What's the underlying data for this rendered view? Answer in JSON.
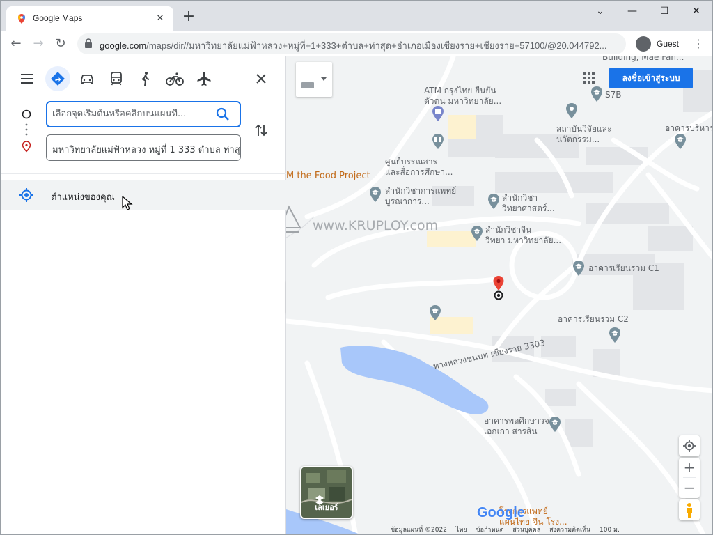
{
  "browser": {
    "tab_title": "Google Maps",
    "new_tab": "+",
    "url_host": "google.com",
    "url_path": "/maps/dir//มหาวิทยาลัยแม่ฟ้าหลวง+หมู่ที่+1+333+ตำบล+ท่าสุด+อำเภอเมืองเชียงราย+เชียงราย+57100/@20.044792...",
    "profile_label": "Guest"
  },
  "panel": {
    "origin_placeholder": "เลือกจุดเริ่มต้นหรือคลิกบนแผนที่...",
    "destination_value": "มหาวิทยาลัยแม่ฟ้าหลวง หมู่ที่ 1 333 ตำบล ท่าสุด",
    "suggestion_label": "ตำแหน่งของคุณ"
  },
  "map": {
    "signin_label": "ลงชื่อเข้าสู่ระบบ",
    "layers_label": "เลเยอร์",
    "watermark": "www.KRUPLOY.com",
    "labels": {
      "building_top": "Building, Mae Fah...",
      "atm": "ATM กรุงไทย ยืนยัน\nตัวตน มหาวิทยาลัย...",
      "s7b": "S7B",
      "research": "สถาบันวิจัยและ\nนวัตกรรม...",
      "admin": "อาคารบริหาร",
      "library": "ศูนย์บรรณสาร\nและสื่อการศึกษา...",
      "food": "M the Food Project",
      "medicine": "สำนักวิชาการแพทย์\nบูรณาการ...",
      "science": "สำนักวิชา\nวิทยาศาสตร์...",
      "chinese": "สำนักวิชาจีน\nวิทยา มหาวิทยาลัย...",
      "c1": "อาคารเรียนรวม C1",
      "c2": "อาคารเรียนรวม C2",
      "road": "ทางหลวงชนบท เชียงราย 3303",
      "gym": "อาคารพลศึกษาวจ\nเอกเกา สารสิน",
      "hospital": "โรงการแพทย์\nแผนไทย-จีน โรง...",
      "google": "Google"
    },
    "footer": {
      "data": "ข้อมูลแผนที่ ©2022",
      "lang": "ไทย",
      "terms": "ข้อกำหนด",
      "privacy": "ส่วนบุคคล",
      "feedback": "ส่งความคิดเห็น",
      "scale": "100 ม."
    }
  }
}
